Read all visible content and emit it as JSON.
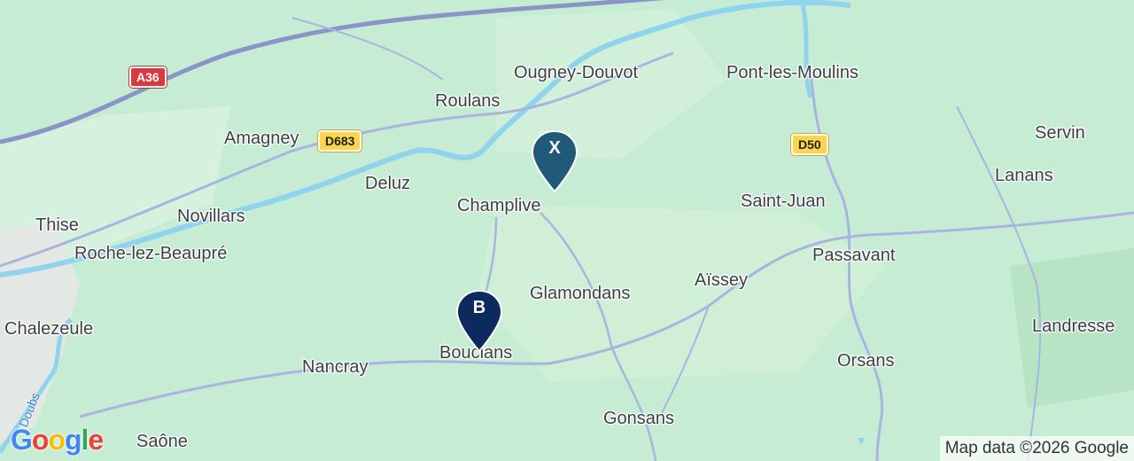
{
  "map": {
    "places": [
      {
        "name": "Ougney-Douvot"
      },
      {
        "name": "Pont-les-Moulins"
      },
      {
        "name": "Roulans"
      },
      {
        "name": "Amagney"
      },
      {
        "name": "Servin"
      },
      {
        "name": "Lanans"
      },
      {
        "name": "Deluz"
      },
      {
        "name": "Champlive"
      },
      {
        "name": "Saint-Juan"
      },
      {
        "name": "Thise"
      },
      {
        "name": "Novillars"
      },
      {
        "name": "Roche-lez-Beaupré"
      },
      {
        "name": "Passavant"
      },
      {
        "name": "Aïssey"
      },
      {
        "name": "Glamondans"
      },
      {
        "name": "Chalezeule"
      },
      {
        "name": "Landresse"
      },
      {
        "name": "Bouclans"
      },
      {
        "name": "Nancray"
      },
      {
        "name": "Orsans"
      },
      {
        "name": "Gonsans"
      },
      {
        "name": "Saône"
      }
    ],
    "river_label": "Doubs",
    "road_shields": [
      {
        "label": "A36",
        "color": "#d93a3d"
      },
      {
        "label": "D683",
        "color": "#fbd54b"
      },
      {
        "label": "D50",
        "color": "#fbd54b"
      }
    ],
    "markers": [
      {
        "label": "X",
        "color": "#1f5a78"
      },
      {
        "label": "B",
        "color": "#0d2a5e"
      }
    ],
    "logo": {
      "letters": [
        "G",
        "o",
        "o",
        "g",
        "l",
        "e"
      ],
      "colors": [
        "#4285f4",
        "#ea4335",
        "#fbbc05",
        "#4285f4",
        "#34a853",
        "#ea4335"
      ]
    },
    "attribution": "Map data ©2026 Google",
    "colors": {
      "land": "#c6ecd3",
      "water": "#8fd3ef",
      "road": "#aab4e0",
      "highway": "#8a94c9"
    }
  }
}
